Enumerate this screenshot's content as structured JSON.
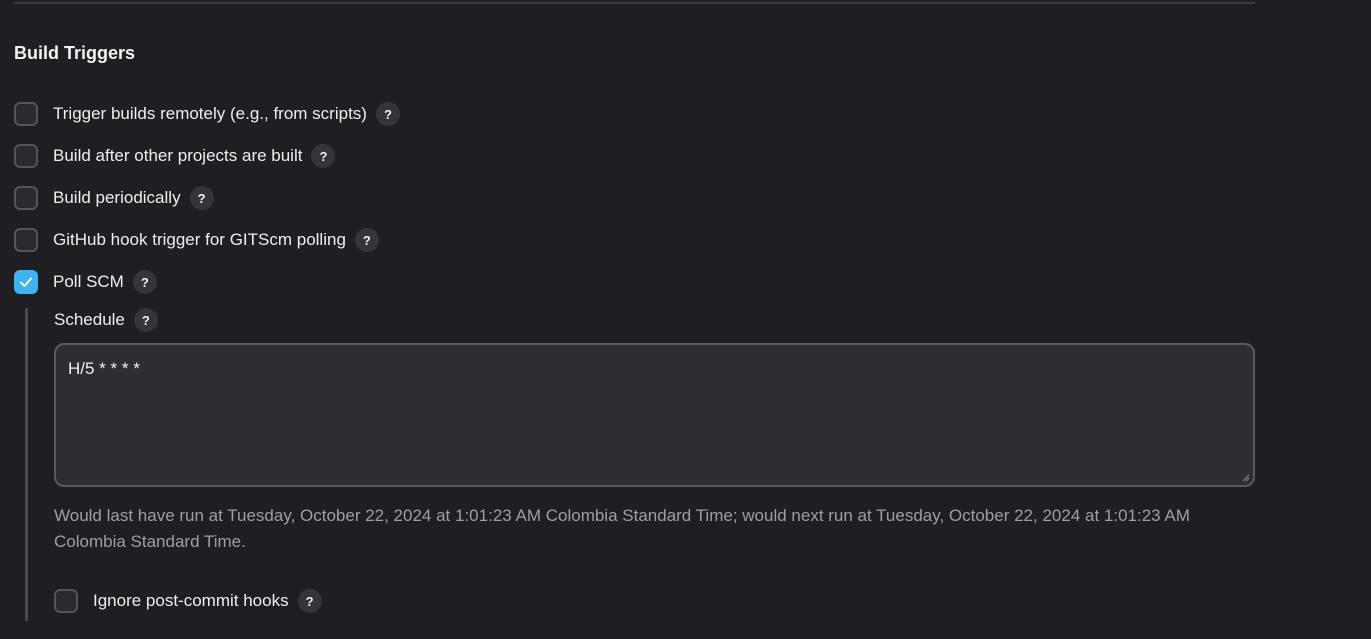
{
  "section": {
    "title": "Build Triggers"
  },
  "triggers": [
    {
      "label": "Trigger builds remotely (e.g., from scripts)",
      "checked": false
    },
    {
      "label": "Build after other projects are built",
      "checked": false
    },
    {
      "label": "Build periodically",
      "checked": false
    },
    {
      "label": "GitHub hook trigger for GITScm polling",
      "checked": false
    },
    {
      "label": "Poll SCM",
      "checked": true
    }
  ],
  "help_symbol": "?",
  "poll_scm": {
    "schedule_label": "Schedule",
    "schedule_value": "H/5 * * * *",
    "schedule_note": "Would last have run at Tuesday, October 22, 2024 at 1:01:23 AM Colombia Standard Time; would next run at Tuesday, October 22, 2024 at 1:01:23 AM Colombia Standard Time.",
    "ignore_hooks": {
      "label": "Ignore post-commit hooks",
      "checked": false
    }
  },
  "colors": {
    "background": "#1f1e23",
    "checkbox_checked": "#3fb4ef",
    "note_text": "#9e9ea6"
  },
  "icons": {
    "checkmark": "check-icon",
    "help": "help-icon",
    "resize": "resize-grip-icon"
  }
}
